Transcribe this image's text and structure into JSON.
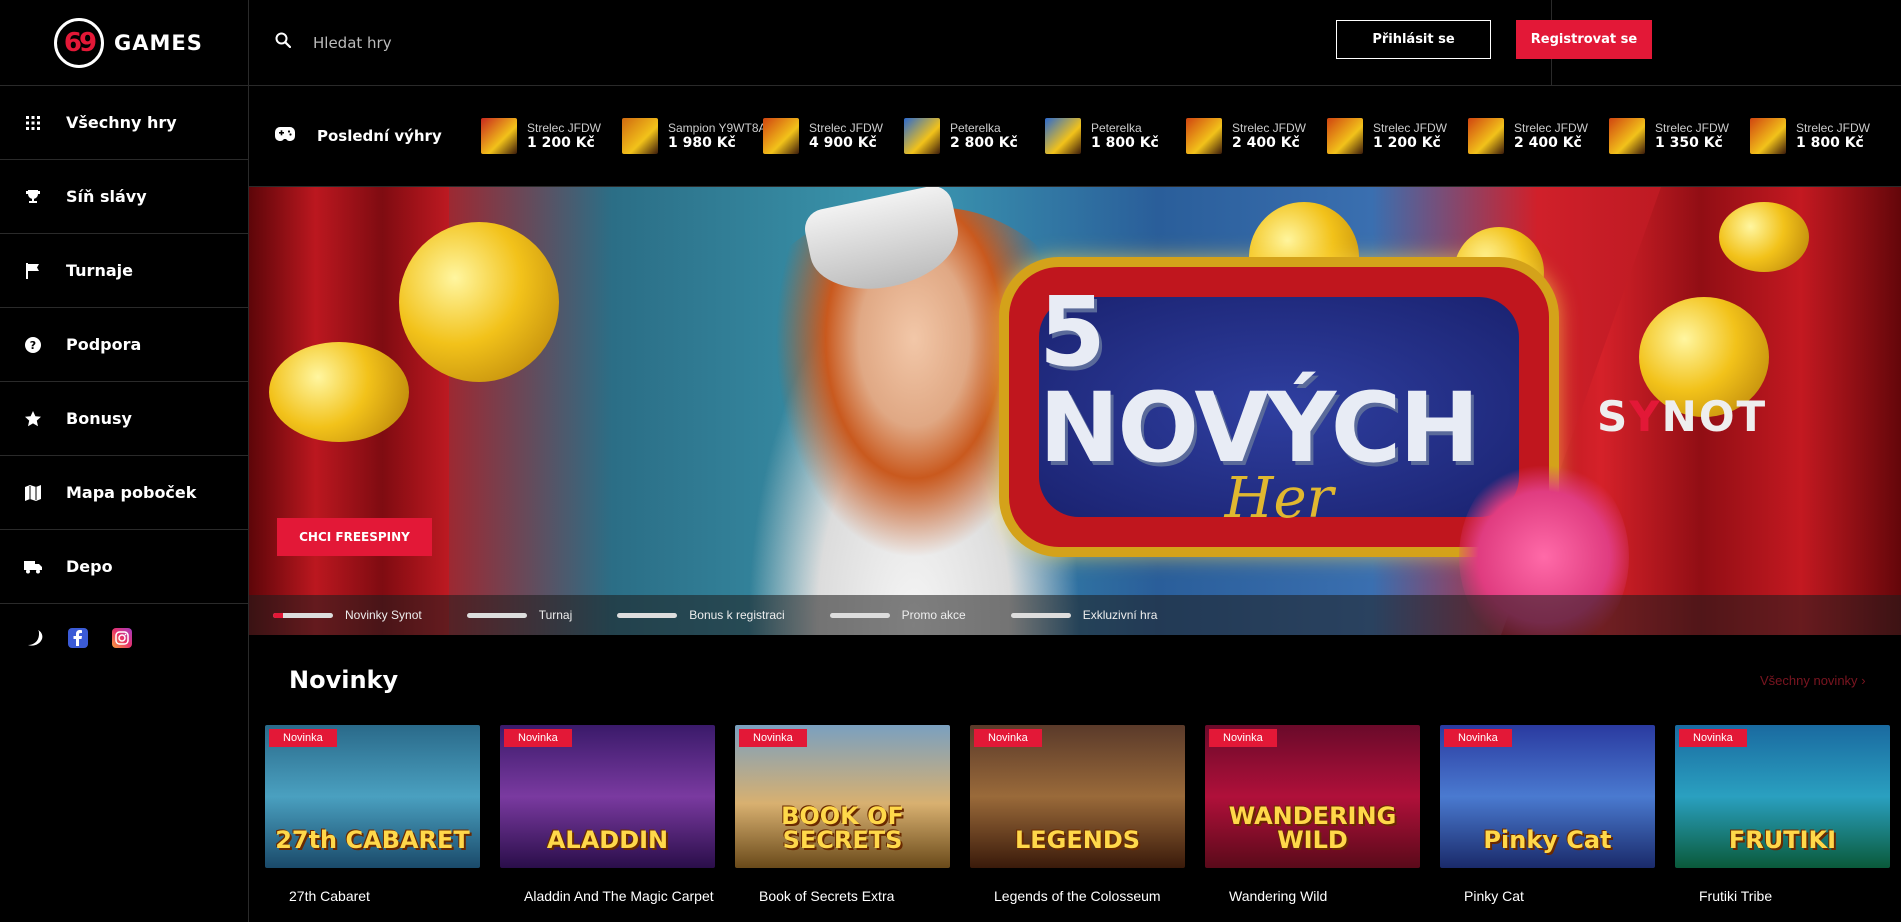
{
  "brand": {
    "logo_number": "69",
    "logo_text": "GAMES"
  },
  "search": {
    "placeholder": "Hledat hry"
  },
  "auth": {
    "login_label": "Přihlásit se",
    "register_label": "Registrovat se"
  },
  "sidebar": {
    "items": [
      {
        "label": "Všechny hry",
        "icon": "grid-icon"
      },
      {
        "label": "Síň slávy",
        "icon": "trophy-icon"
      },
      {
        "label": "Turnaje",
        "icon": "flag-icon"
      },
      {
        "label": "Podpora",
        "icon": "help-icon"
      },
      {
        "label": "Bonusy",
        "icon": "star-icon"
      },
      {
        "label": "Mapa poboček",
        "icon": "map-icon"
      },
      {
        "label": "Depo",
        "icon": "truck-icon"
      }
    ],
    "social": [
      "moon-icon",
      "facebook-icon",
      "instagram-icon"
    ]
  },
  "wins": {
    "title": "Poslední výhry",
    "items": [
      {
        "name": "Strelec JFDW",
        "amount": "1 200 Kč",
        "color": "#c8281e"
      },
      {
        "name": "Sampion Y9WT8A",
        "amount": "1 980 Kč",
        "color": "#d06a10"
      },
      {
        "name": "Strelec JFDW",
        "amount": "4 900 Kč",
        "color": "#d04410"
      },
      {
        "name": "Peterelka",
        "amount": "2 800 Kč",
        "color": "#2a6ad0"
      },
      {
        "name": "Peterelka",
        "amount": "1 800 Kč",
        "color": "#2a6ad0"
      },
      {
        "name": "Strelec JFDW",
        "amount": "2 400 Kč",
        "color": "#d04410"
      },
      {
        "name": "Strelec JFDW",
        "amount": "1 200 Kč",
        "color": "#d04410"
      },
      {
        "name": "Strelec JFDW",
        "amount": "2 400 Kč",
        "color": "#d04410"
      },
      {
        "name": "Strelec JFDW",
        "amount": "1 350 Kč",
        "color": "#d04410"
      },
      {
        "name": "Strelec JFDW",
        "amount": "1 800 Kč",
        "color": "#d04410"
      }
    ]
  },
  "banner": {
    "title": "5 NOVÝCH",
    "subtitle": "Her",
    "provider": "SYNOT",
    "cta_label": "CHCI FREESPINY",
    "tabs": [
      "Novinky Synot",
      "Turnaj",
      "Bonus k registraci",
      "Promo akce",
      "Exkluzivní hra"
    ]
  },
  "novinky": {
    "title": "Novinky",
    "all_link": "Všechny novinky",
    "badge": "Novinka",
    "games": [
      {
        "title": "27th Cabaret",
        "logo": "27th CABARET",
        "bg": "linear-gradient(180deg,#2a6a8a,#4aa0c0 50%,#1a4a6a)"
      },
      {
        "title": "Aladdin And The Magic Carpet",
        "logo": "ALADDIN",
        "bg": "linear-gradient(180deg,#3a1a6a,#7a3aa0 50%,#2a0e4a)"
      },
      {
        "title": "Book of Secrets Extra",
        "logo": "BOOK OF SECRETS",
        "bg": "linear-gradient(180deg,#7aa0c0,#d8b070 55%,#6a4a1a)"
      },
      {
        "title": "Legends of the Colosseum",
        "logo": "LEGENDS",
        "bg": "linear-gradient(180deg,#5a3a2a,#9a6a3a 50%,#3a1a0a)"
      },
      {
        "title": "Wandering Wild",
        "logo": "WANDERING WILD",
        "bg": "linear-gradient(180deg,#6a0a2a,#b0103a 50%,#5a0a1a)"
      },
      {
        "title": "Pinky Cat",
        "logo": "Pinky Cat",
        "bg": "linear-gradient(180deg,#2a3aa0,#4a7ad0 50%,#1a2a6a)"
      },
      {
        "title": "Frutiki Tribe",
        "logo": "FRUTIKI",
        "bg": "linear-gradient(180deg,#1a6aa0,#2aa0c0 50%,#0a5a3a)"
      }
    ]
  }
}
